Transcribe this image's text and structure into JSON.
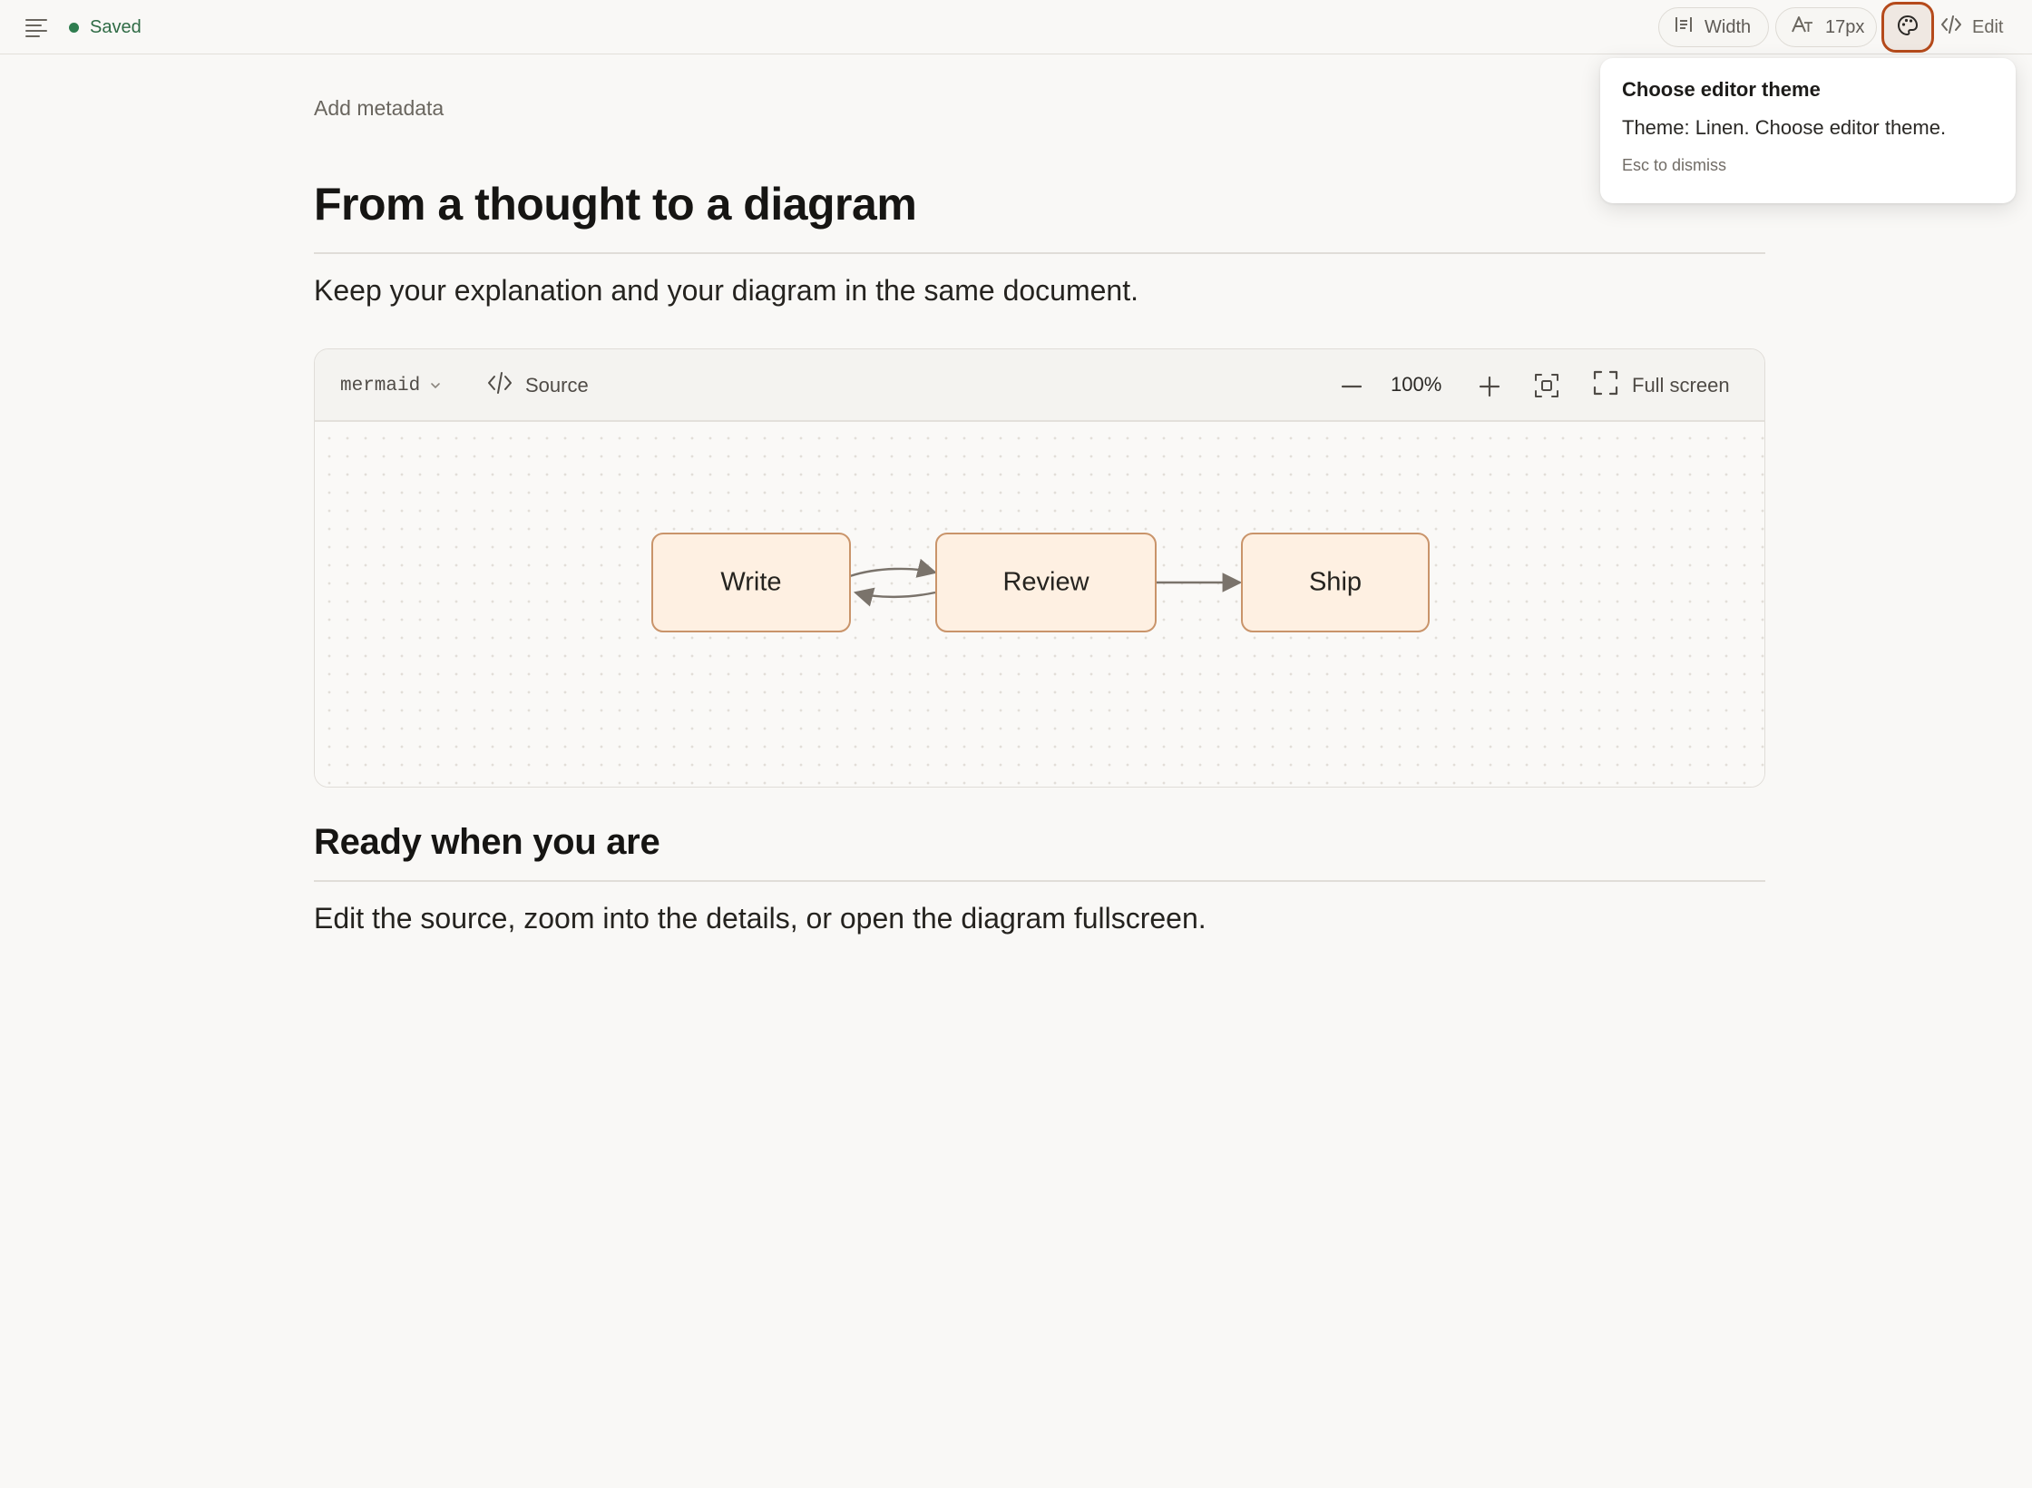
{
  "topbar": {
    "status": "Saved",
    "width_label": "Width",
    "font_size_label": "17px",
    "edit_label": "Edit"
  },
  "theme_popover": {
    "title": "Choose editor theme",
    "body": "Theme: Linen. Choose editor theme.",
    "hint": "Esc to dismiss"
  },
  "document": {
    "add_metadata": "Add metadata",
    "heading1": "From a thought to a diagram",
    "paragraph1": "Keep your explanation and your diagram in the same document.",
    "heading2": "Ready when you are",
    "paragraph2": "Edit the source, zoom into the details, or open the diagram fullscreen."
  },
  "diagram_block": {
    "language": "mermaid",
    "source_label": "Source",
    "zoom_level": "100%",
    "fullscreen_label": "Full screen",
    "nodes": [
      {
        "id": "write",
        "label": "Write"
      },
      {
        "id": "review",
        "label": "Review"
      },
      {
        "id": "ship",
        "label": "Ship"
      }
    ],
    "edges": [
      {
        "from": "write",
        "to": "review"
      },
      {
        "from": "review",
        "to": "write"
      },
      {
        "from": "review",
        "to": "ship"
      }
    ]
  },
  "colors": {
    "accent": "#b54a1b",
    "saved_dot": "#2f7d4f",
    "node_fill": "#fef0e2",
    "node_stroke": "#c9946a",
    "edge": "#7a736b"
  },
  "icons": {
    "menu": "menu-icon",
    "width": "width-icon",
    "font_size": "font-size-icon",
    "theme": "palette-icon",
    "edit": "code-icon",
    "source": "code-icon",
    "zoom_out": "minus-icon",
    "zoom_in": "plus-icon",
    "fit": "fit-view-icon",
    "fullscreen": "fullscreen-icon",
    "language_dropdown": "chevron-down-icon"
  }
}
